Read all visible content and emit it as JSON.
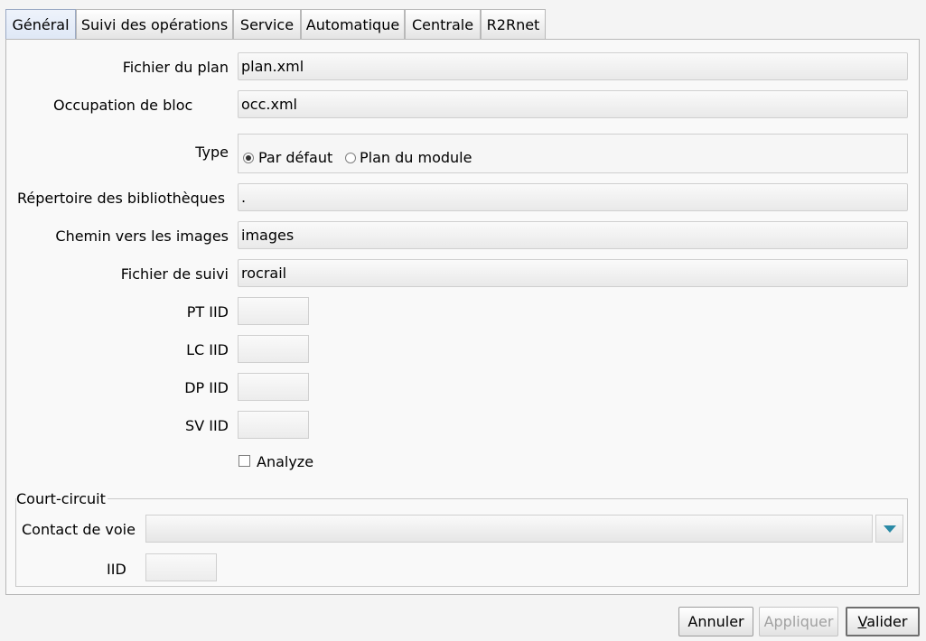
{
  "tabs": [
    "Général",
    "Suivi des opérations",
    "Service",
    "Automatique",
    "Centrale",
    "R2Rnet"
  ],
  "active_tab": "Général",
  "form": {
    "plan_file_label": "Fichier du plan",
    "plan_file_value": "plan.xml",
    "block_occupation_label": "Occupation de bloc",
    "block_occupation_value": "occ.xml",
    "type_label": "Type",
    "type_options": [
      "Par défaut",
      "Plan du module"
    ],
    "type_selected": "Par défaut",
    "library_dir_label": "Répertoire des bibliothèques",
    "library_dir_value": ".",
    "image_path_label": "Chemin vers les images",
    "image_path_value": "images",
    "trace_file_label": "Fichier de suivi",
    "trace_file_value": "rocrail",
    "pt_iid_label": "PT IID",
    "pt_iid_value": "",
    "lc_iid_label": "LC IID",
    "lc_iid_value": "",
    "dp_iid_label": "DP IID",
    "dp_iid_value": "",
    "sv_iid_label": "SV IID",
    "sv_iid_value": "",
    "analyze_label": "Analyze",
    "analyze_checked": false
  },
  "short_circuit": {
    "group_title": "Court-circuit",
    "contact_label": "Contact de voie",
    "contact_value": "",
    "iid_label": "IID",
    "iid_value": ""
  },
  "buttons": {
    "cancel": "Annuler",
    "apply": "Appliquer",
    "ok_first": "V",
    "ok_rest": "alider"
  },
  "colors": {
    "active_tab_bg": "#dfe8f6",
    "dropdown_arrow": "#2a8aa6"
  },
  "icons": {
    "dropdown": "chevron-down-icon"
  }
}
